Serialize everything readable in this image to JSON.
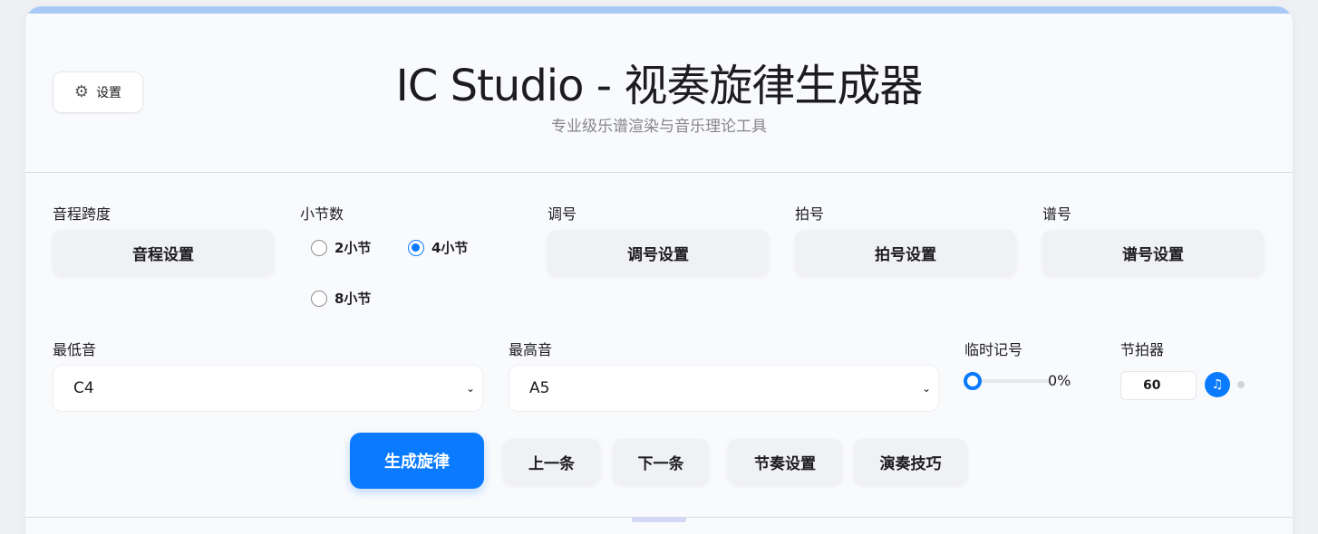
{
  "header": {
    "settings_label": "设置",
    "settings_icon": "gear-icon",
    "title": "IC Studio - 视奏旋律生成器",
    "subtitle": "专业级乐谱渲染与音乐理论工具"
  },
  "controls": {
    "interval": {
      "label": "音程跨度",
      "button": "音程设置"
    },
    "measures": {
      "label": "小节数",
      "options": [
        "2小节",
        "4小节",
        "8小节"
      ],
      "selected": "4小节"
    },
    "key": {
      "label": "调号",
      "button": "调号设置"
    },
    "time": {
      "label": "拍号",
      "button": "拍号设置"
    },
    "clef": {
      "label": "谱号",
      "button": "谱号设置"
    },
    "lowest": {
      "label": "最低音",
      "value": "C4"
    },
    "highest": {
      "label": "最高音",
      "value": "A5"
    },
    "accidentals": {
      "label": "临时记号",
      "value_text": "0%",
      "value": 0
    },
    "metronome": {
      "label": "节拍器",
      "bpm": "60",
      "icon": "music-note-icon"
    }
  },
  "actions": {
    "generate": "生成旋律",
    "prev": "上一条",
    "next": "下一条",
    "rhythm": "节奏设置",
    "tips": "演奏技巧"
  },
  "colors": {
    "accent": "#0a7aff",
    "stripe": "#a8c9f5"
  }
}
